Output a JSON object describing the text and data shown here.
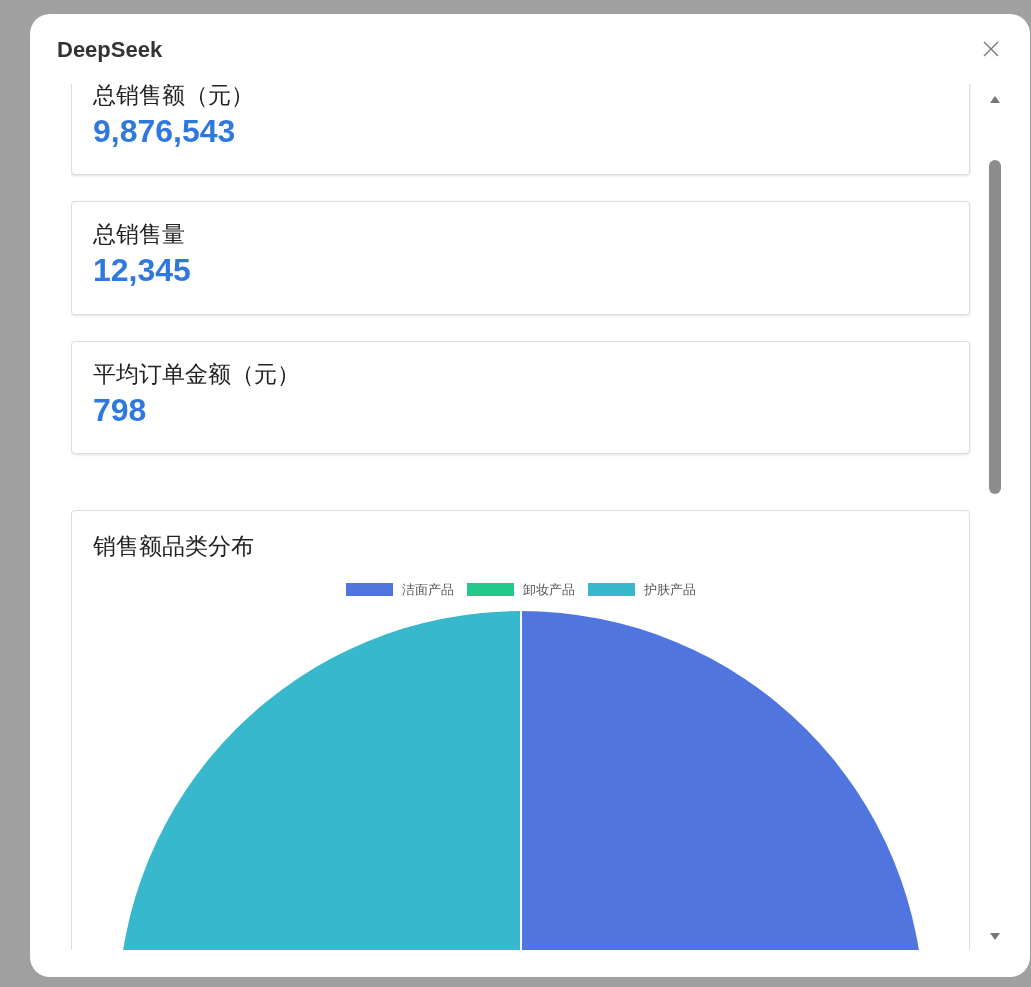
{
  "dialog": {
    "title": "DeepSeek"
  },
  "stats": [
    {
      "label": "总销售额（元）",
      "value": "9,876,543"
    },
    {
      "label": "总销售量",
      "value": "12,345"
    },
    {
      "label": "平均订单金额（元）",
      "value": "798"
    }
  ],
  "chart_card": {
    "title": "销售额品类分布",
    "legend": [
      {
        "label": "洁面产品",
        "color": "#5075de"
      },
      {
        "label": "卸妆产品",
        "color": "#20c98a"
      },
      {
        "label": "护肤产品",
        "color": "#37b8cc"
      }
    ]
  }
}
